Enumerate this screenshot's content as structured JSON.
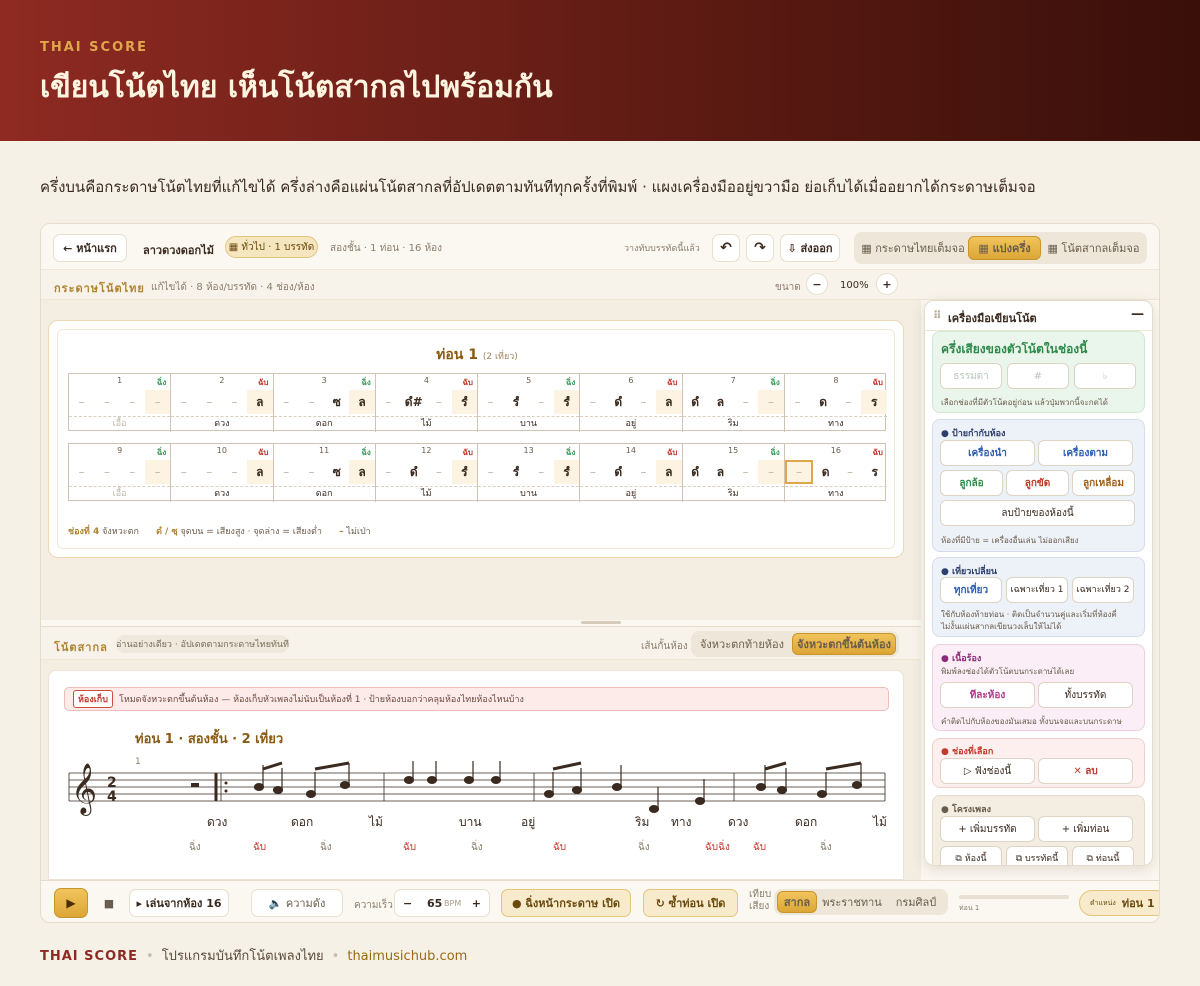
{
  "hero": {
    "eyebrow": "THAI SCORE",
    "title": "เขียนโน้ตไทย เห็นโน้ตสากลไปพร้อมกัน"
  },
  "intro": "ครึ่งบนคือกระดาษโน้ตไทยที่แก้ไขได้ ครึ่งล่างคือแผ่นโน้ตสากลที่อัปเดตตามทันทีทุกครั้งที่พิมพ์ · แผงเครื่องมืออยู่ขวามือ ย่อเก็บได้เมื่ออยากได้กระดาษเต็มจอ",
  "topbar": {
    "home": "← หน้าแรก",
    "song": "ลาวดวงดอกไม้",
    "badge": "▦ ทั่วไป · 1 บรรทัด",
    "meta": "สองชั้น · 1 ท่อน · 16 ห้อง",
    "paste": "วางทับบรรทัดนี้แล้ว",
    "undo": "↶",
    "redo": "↷",
    "export": "⇩ ส่งออก",
    "views": [
      "▦ กระดาษไทยเต็มจอ",
      "▦ แบ่งครึ่ง",
      "▦ โน้ตสากลเต็มจอ"
    ]
  },
  "paperbar": {
    "label": "กระดาษโน้ตไทย",
    "desc": "แก้ไขได้ · 8 ห้อง/บรรทัด · 4 ช่อง/ห้อง",
    "size": "ขนาด",
    "minus": "−",
    "zoom": "100%",
    "plus": "+"
  },
  "paper": {
    "title": "ท่อน 1",
    "rounds": "(2 เที่ยว)",
    "rows": [
      [
        {
          "n": "1",
          "c": "ฉิ่ง",
          "cc": "#3a9a5a",
          "notes": [
            "–",
            "–",
            "–",
            "–"
          ],
          "hl": 3,
          "lyr": "เอื้อ",
          "lyrc": "#c2b7a8"
        },
        {
          "n": "2",
          "c": "ฉับ",
          "cc": "#c1392b",
          "notes": [
            "–",
            "–",
            "–",
            "ล"
          ],
          "hl": 3,
          "lyr": "ดวง"
        },
        {
          "n": "3",
          "c": "ฉิ่ง",
          "cc": "#3a9a5a",
          "notes": [
            "–",
            "–",
            "ซ",
            "ล"
          ],
          "hl": 3,
          "lyr": "ดอก"
        },
        {
          "n": "4",
          "c": "ฉับ",
          "cc": "#c1392b",
          "notes": [
            "–",
            "ดํ#",
            "–",
            "รํ"
          ],
          "hl": 3,
          "lyr": "ไม้"
        },
        {
          "n": "5",
          "c": "ฉิ่ง",
          "cc": "#3a9a5a",
          "notes": [
            "–",
            "รํ",
            "–",
            "รํ"
          ],
          "hl": 3,
          "lyr": "บาน"
        },
        {
          "n": "6",
          "c": "ฉับ",
          "cc": "#c1392b",
          "notes": [
            "–",
            "ดํ",
            "–",
            "ล"
          ],
          "hl": 3,
          "lyr": "อยู่"
        },
        {
          "n": "7",
          "c": "ฉิ่ง",
          "cc": "#3a9a5a",
          "notes": [
            "ดํ",
            "ล",
            "–",
            "–"
          ],
          "hl": 3,
          "lyr": "ริม"
        },
        {
          "n": "8",
          "c": "ฉับ",
          "cc": "#c1392b",
          "notes": [
            "–",
            "ด",
            "–",
            "ร"
          ],
          "hl": 3,
          "lyr": "ทาง"
        }
      ],
      [
        {
          "n": "9",
          "c": "ฉิ่ง",
          "cc": "#3a9a5a",
          "notes": [
            "–",
            "–",
            "–",
            "–"
          ],
          "hl": 3,
          "lyr": "เอื้อ",
          "lyrc": "#c2b7a8"
        },
        {
          "n": "10",
          "c": "ฉับ",
          "cc": "#c1392b",
          "notes": [
            "–",
            "–",
            "–",
            "ล"
          ],
          "hl": 3,
          "lyr": "ดวง"
        },
        {
          "n": "11",
          "c": "ฉิ่ง",
          "cc": "#3a9a5a",
          "notes": [
            "–",
            "–",
            "ซ",
            "ล"
          ],
          "hl": 3,
          "lyr": "ดอก"
        },
        {
          "n": "12",
          "c": "ฉับ",
          "cc": "#c1392b",
          "notes": [
            "–",
            "ดํ",
            "–",
            "รํ"
          ],
          "hl": 3,
          "lyr": "ไม้"
        },
        {
          "n": "13",
          "c": "ฉิ่ง",
          "cc": "#3a9a5a",
          "notes": [
            "–",
            "รํ",
            "–",
            "รํ"
          ],
          "hl": 3,
          "lyr": "บาน"
        },
        {
          "n": "14",
          "c": "ฉับ",
          "cc": "#c1392b",
          "notes": [
            "–",
            "ดํ",
            "–",
            "ล"
          ],
          "hl": 3,
          "lyr": "อยู่"
        },
        {
          "n": "15",
          "c": "ฉิ่ง",
          "cc": "#3a9a5a",
          "notes": [
            "ดํ",
            "ล",
            "–",
            "–"
          ],
          "hl": 3,
          "lyr": "ริม"
        },
        {
          "n": "16",
          "c": "ฉับ",
          "cc": "#c1392b",
          "notes": [
            "–",
            "ด",
            "–",
            "ร"
          ],
          "hl": 0,
          "sel": 0,
          "lyr": "ทาง"
        }
      ]
    ],
    "legend1": "ช่องที่ 4",
    "legend1d": " จังหวะตก",
    "legend2": "ดํ / ซฺ",
    "legend2d": " จุดบน = เสียงสูง · จุดล่าง = เสียงต่ำ",
    "legend3": "–",
    "legend3d": " ไม่เป่า"
  },
  "west": {
    "label": "โน้ตสากล",
    "desc": "อ่านอย่างเดียว · อัปเดตตามกระดาษไทยทันที",
    "barline": "เส้นกั้นห้อง",
    "opt1": "จังหวะตกท้ายห้อง",
    "opt2": "จังหวะตกขึ้นต้นห้อง",
    "alert_tag": "ห้องเก็บ",
    "alert": "โหมดจังหวะตกขึ้นต้นห้อง — ห้องเก็บหัวเพลงไม่นับเป็นห้องที่ 1 · ป้ายห้องบอกว่าคลุมห้องไทยห้องไหนบ้าง",
    "section": "ท่อน 1 · สองชั้น · 2 เที่ยว",
    "measure": "1",
    "lyrics": [
      "ดวง",
      "ดอก",
      "ไม้",
      "บาน",
      "อยู่",
      "ริม",
      "ทาง",
      "ดวง",
      "ดอก",
      "ไม้"
    ],
    "chings": [
      {
        "t": "ฉิ่ง",
        "c": "#8b7e6d"
      },
      {
        "t": "ฉับ",
        "c": "#c1392b"
      },
      {
        "t": "ฉิ่ง",
        "c": "#8b7e6d"
      },
      {
        "t": "ฉับ",
        "c": "#c1392b"
      },
      {
        "t": "ฉิ่ง",
        "c": "#8b7e6d"
      },
      {
        "t": "ฉับ",
        "c": "#c1392b"
      },
      {
        "t": "ฉิ่ง",
        "c": "#8b7e6d"
      },
      {
        "t": "ฉับฉิ่ง",
        "c": "#c1392b"
      },
      {
        "t": "ฉับ",
        "c": "#c1392b"
      },
      {
        "t": "ฉิ่ง",
        "c": "#8b7e6d"
      }
    ]
  },
  "bottom": {
    "play": "▶",
    "stop": "■",
    "from": "▸ เล่นจากห้อง 16",
    "volume": "🔈 ความดัง",
    "speed": "ความเร็ว",
    "minus": "−",
    "bpm": "65",
    "bpm_unit": "BPM",
    "plus": "+",
    "follow": "● ฉิ่งหน้ากระดาษ เปิด",
    "repeat": "↻ ซ้ำท่อน เปิด",
    "tuning_label": "เทียบเสียง",
    "tunings": [
      "สากล",
      "พระราชทาน",
      "กรมศิลป์"
    ],
    "progress": "ท่อน 1",
    "pos_label": "ตำแหน่ง",
    "pos": "ท่อน 1"
  },
  "tool": {
    "title": "เครื่องมือเขียนโน้ต",
    "collapse": "—",
    "pitch_title": "ครึ่งเสียงของตัวโน้ตในช่องนี้",
    "pitch_btns": [
      "ธรรมดา",
      "#",
      "♭"
    ],
    "pitch_desc": "เลือกช่องที่มีตัวโน้ตอยู่ก่อน แล้วปุ่มพวกนี้จะกดได้",
    "tag_title": "● ป้ายกำกับห้อง",
    "tag_btns": [
      "เครื่องนำ",
      "เครื่องตาม",
      "ลูกล้อ",
      "ลูกขัด",
      "ลูกเหลื่อม"
    ],
    "tag_clear": "ลบป้ายของห้องนี้",
    "tag_desc": "ห้องที่มีป้าย = เครื่องอื่นเล่น ไม่ออกเสียง",
    "round_title": "● เที่ยวเปลี่ยน",
    "round_btns": [
      "ทุกเที่ยว",
      "เฉพาะเที่ยว 1",
      "เฉพาะเที่ยว 2"
    ],
    "round_desc1": "ใช้กับห้องท้ายท่อน · ติดเป็นจำนวนคู่และเริ่มที่ห้องคี่",
    "round_desc2": "ไม่งั้นแผ่นสากลเขียนวงเล็บให้ไม่ได้",
    "lyr_title": "● เนื้อร้อง",
    "lyr_desc1": "พิมพ์ลงช่องได้ตัวโน้ตบนกระดาษได้เลย",
    "lyr_btns": [
      "ทีละห้อง",
      "ทั้งบรรทัด"
    ],
    "lyr_desc2": "คำติดไปกับห้องของมันเสมอ ทั้งบนจอและบนกระดาษ",
    "sel_title": "● ช่องที่เลือก",
    "sel_play": "▷ ฟังช่องนี้",
    "sel_del": "✕ ลบ",
    "struct_title": "● โครงเพลง",
    "struct_btns": [
      "+ เพิ่มบรรทัด",
      "+ เพิ่มท่อน"
    ],
    "struct_btns2": [
      "⧉ ห้องนี้",
      "⧉ บรรทัดนี้",
      "⧉ ท่อนนี้"
    ]
  },
  "footer": {
    "brand": "THAI SCORE",
    "desc": "โปรแกรมบันทึกโน้ตเพลงไทย",
    "url": "thaimusichub.com"
  }
}
